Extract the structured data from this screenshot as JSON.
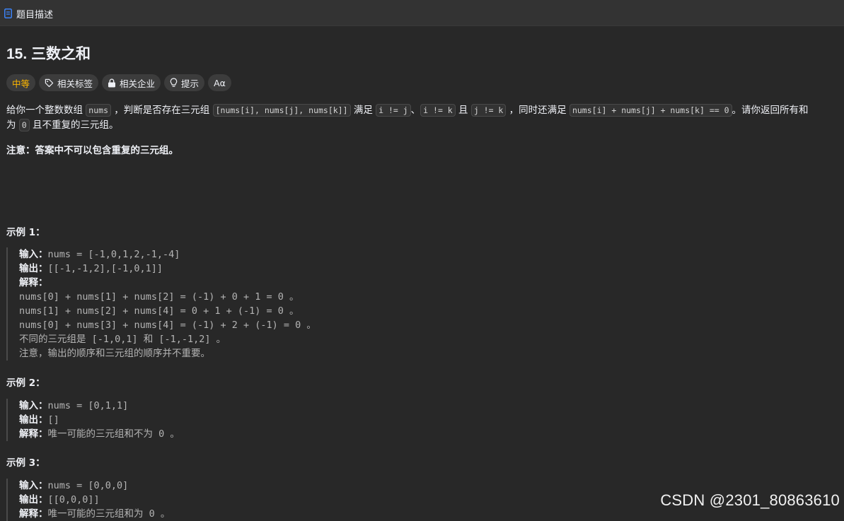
{
  "tab": {
    "label": "题目描述"
  },
  "problem": {
    "title": "15. 三数之和",
    "difficulty": "中等",
    "tags": {
      "related_tags": "相关标签",
      "related_companies": "相关企业",
      "hints": "提示",
      "font": "Aα"
    },
    "desc": {
      "p1": "给你一个整数数组",
      "c1": "nums",
      "p2": "，判断是否存在三元组",
      "c2": "[nums[i], nums[j], nums[k]]",
      "p3": "满足",
      "c3": "i != j",
      "p4": "、",
      "c4": "i != k",
      "p5": "且",
      "c5": "j != k",
      "p6": "，同时还满足",
      "c6": "nums[i] + nums[j] + nums[k] == 0",
      "p7": "。请你返回所有和",
      "p8": "为",
      "c7": "0",
      "p9": "且不重复的三元组。"
    },
    "note_label": "注意：",
    "note_text": "答案中不可以包含重复的三元组。"
  },
  "examples": [
    {
      "title": "示例 1：",
      "input_label": "输入：",
      "input": "nums = [-1,0,1,2,-1,-4]",
      "output_label": "输出：",
      "output": "[[-1,-1,2],[-1,0,1]]",
      "explain_label": "解释：",
      "explain_lines": [
        "nums[0] + nums[1] + nums[2] = (-1) + 0 + 1 = 0 。",
        "nums[1] + nums[2] + nums[4] = 0 + 1 + (-1) = 0 。",
        "nums[0] + nums[3] + nums[4] = (-1) + 2 + (-1) = 0 。",
        "不同的三元组是 [-1,0,1] 和 [-1,-1,2] 。",
        "注意，输出的顺序和三元组的顺序并不重要。"
      ]
    },
    {
      "title": "示例 2：",
      "input_label": "输入：",
      "input": "nums = [0,1,1]",
      "output_label": "输出：",
      "output": "[]",
      "explain_label": "解释：",
      "explain": "唯一可能的三元组和不为 0 。"
    },
    {
      "title": "示例 3：",
      "input_label": "输入：",
      "input": "nums = [0,0,0]",
      "output_label": "输出：",
      "output": "[[0,0,0]]",
      "explain_label": "解释：",
      "explain": "唯一可能的三元组和为 0 。"
    }
  ],
  "watermark": "CSDN @2301_80863610",
  "colors": {
    "background": "#282828",
    "difficulty_medium": "#ffb800",
    "tab_icon": "#3b82f6"
  }
}
